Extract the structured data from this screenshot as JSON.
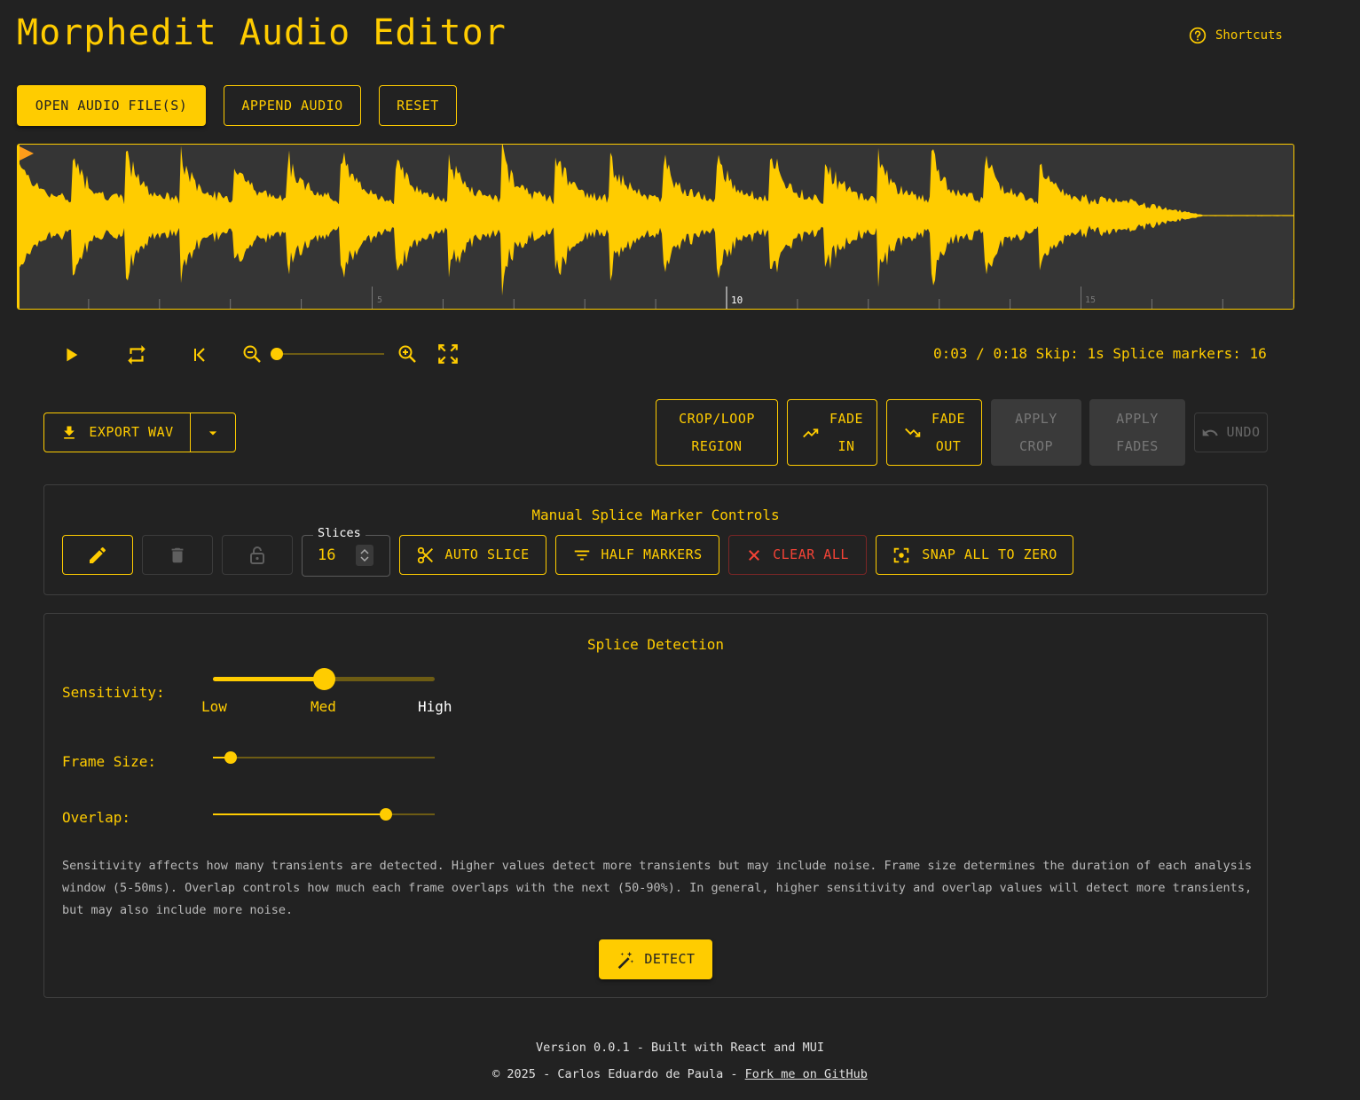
{
  "app": {
    "title": "Morphedit Audio Editor",
    "shortcuts_label": "Shortcuts"
  },
  "toolbar": {
    "open_label": "OPEN AUDIO FILE(S)",
    "append_label": "APPEND AUDIO",
    "reset_label": "RESET"
  },
  "waveform": {
    "color": "#ffcc00",
    "tick_labels": [
      "5",
      "10",
      "15"
    ]
  },
  "transport": {
    "current_time": "0:03",
    "duration": "0:18",
    "time_separator": "/",
    "skip_label": "Skip:",
    "skip_value": "1s",
    "markers_label": "Splice markers:",
    "markers_count": "16",
    "zoom_level": 0
  },
  "actions": {
    "export_label": "EXPORT WAV",
    "crop_loop_line1": "CROP/LOOP",
    "crop_loop_line2": "REGION",
    "fade_in_line1": "FADE",
    "fade_in_line2": "IN",
    "fade_out_line1": "FADE",
    "fade_out_line2": "OUT",
    "apply_crop_line1": "APPLY",
    "apply_crop_line2": "CROP",
    "apply_fades_line1": "APPLY",
    "apply_fades_line2": "FADES",
    "undo_label": "UNDO"
  },
  "manual": {
    "title": "Manual Splice Marker Controls",
    "slices_label": "Slices",
    "slices_value": "16",
    "auto_slice_label": "AUTO SLICE",
    "half_markers_label": "HALF MARKERS",
    "clear_all_label": "CLEAR ALL",
    "snap_label": "SNAP ALL TO ZERO"
  },
  "detection": {
    "title": "Splice Detection",
    "sensitivity_label": "Sensitivity:",
    "sensitivity_value": 0.5,
    "sensitivity_marks": [
      "Low",
      "Med",
      "High"
    ],
    "frame_size_label": "Frame Size:",
    "frame_size_value": 0.08,
    "overlap_label": "Overlap:",
    "overlap_value": 0.78,
    "description": "Sensitivity affects how many transients are detected. Higher values detect more transients but may include noise. Frame size determines the duration of each analysis window (5-50ms). Overlap controls how much each frame overlaps with the next (50-90%). In general, higher sensitivity and overlap values will detect more transients, but may also include more noise.",
    "detect_label": "DETECT"
  },
  "footer": {
    "version_line": "Version 0.0.1 - Built with React and MUI",
    "copyright_line": "© 2025 - Carlos Eduardo de Paula -",
    "github_link": "Fork me on GitHub"
  }
}
